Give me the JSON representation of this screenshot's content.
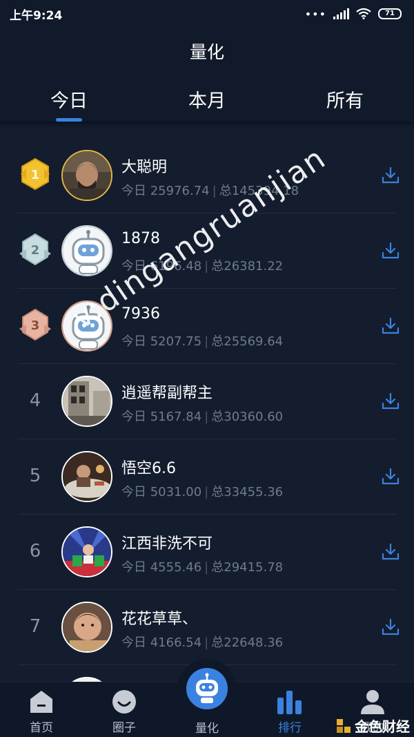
{
  "status_bar": {
    "time": "上午9:24",
    "dots": "•••",
    "battery": "71"
  },
  "header": {
    "title": "量化",
    "tabs": [
      {
        "label": "今日",
        "active": true
      },
      {
        "label": "本月",
        "active": false
      },
      {
        "label": "所有",
        "active": false
      }
    ]
  },
  "ranking": [
    {
      "rank": "1",
      "name": "大聪明",
      "today_label": "今日",
      "today": "25976.74",
      "total_label": "总",
      "total": "145394.18"
    },
    {
      "rank": "2",
      "name": "1878",
      "today_label": "今日",
      "today": "6196.48",
      "total_label": "总",
      "total": "26381.22"
    },
    {
      "rank": "3",
      "name": "7936",
      "today_label": "今日",
      "today": "5207.75",
      "total_label": "总",
      "total": "25569.64"
    },
    {
      "rank": "4",
      "name": "逍遥帮副帮主",
      "today_label": "今日",
      "today": "5167.84",
      "total_label": "总",
      "total": "30360.60"
    },
    {
      "rank": "5",
      "name": "悟空6.6",
      "today_label": "今日",
      "today": "5031.00",
      "total_label": "总",
      "total": "33455.36"
    },
    {
      "rank": "6",
      "name": "江西非洗不可",
      "today_label": "今日",
      "today": "4555.46",
      "total_label": "总",
      "total": "29415.78"
    },
    {
      "rank": "7",
      "name": "花花草草、",
      "today_label": "今日",
      "today": "4166.54",
      "total_label": "总",
      "total": "22648.36"
    }
  ],
  "watermark": "v:dingangruanjian",
  "bottom_nav": {
    "items": [
      {
        "label": "首页",
        "icon": "home-icon"
      },
      {
        "label": "圈子",
        "icon": "circle-chat-icon"
      },
      {
        "label": "量化",
        "icon": "robot-icon"
      },
      {
        "label": "排行",
        "icon": "bar-chart-icon",
        "active": true
      },
      {
        "label": "我的",
        "icon": "user-icon"
      }
    ]
  },
  "brand": "金色财经",
  "colors": {
    "background": "#131d2e",
    "accent": "#3b82e0",
    "gold": "#e6b844",
    "silver": "#c9d4dc",
    "bronze": "#d9a08a"
  }
}
